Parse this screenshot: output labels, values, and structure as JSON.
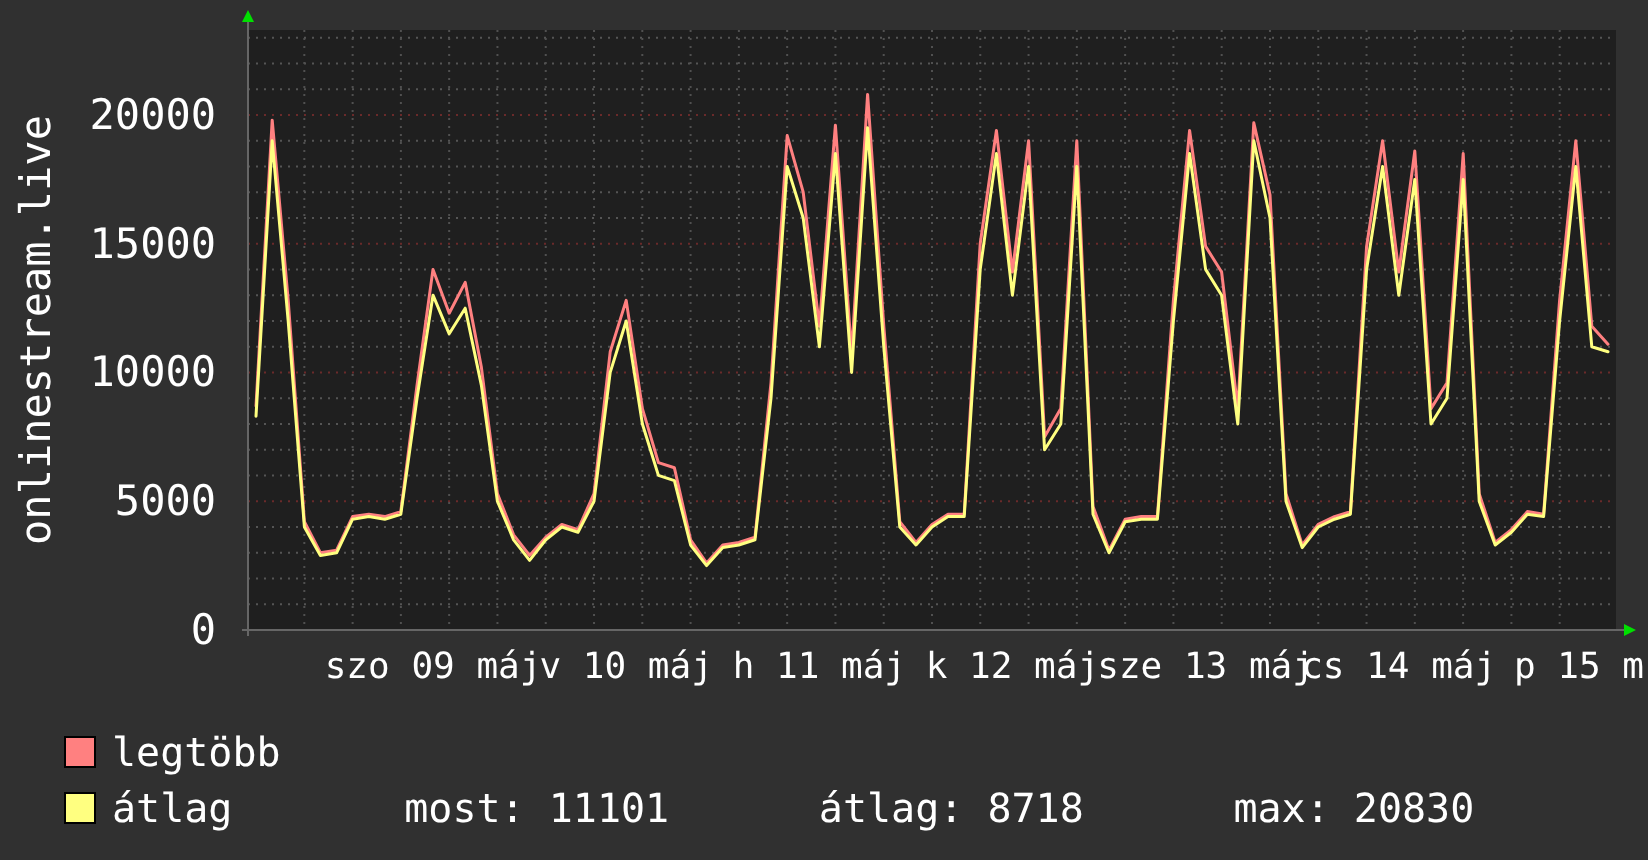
{
  "graph": {
    "chart_data": {
      "type": "line",
      "grid": true,
      "ylabel": "onlinestream.live",
      "ylim": [
        0,
        23300
      ],
      "yticks": [
        0,
        5000,
        10000,
        15000,
        20000
      ],
      "categories": [
        null,
        null,
        null,
        null,
        null,
        null,
        null,
        null,
        null,
        null,
        null,
        "szo 09 máj",
        null,
        null,
        null,
        null,
        null,
        null,
        null,
        null,
        null,
        null,
        null,
        "v 10 máj",
        null,
        null,
        null,
        null,
        null,
        null,
        null,
        null,
        null,
        null,
        null,
        "h 11 máj",
        null,
        null,
        null,
        null,
        null,
        null,
        null,
        null,
        null,
        null,
        null,
        "k 12 máj",
        null,
        null,
        null,
        null,
        null,
        null,
        null,
        null,
        null,
        null,
        null,
        "sze 13 máj",
        null,
        null,
        null,
        null,
        null,
        null,
        null,
        null,
        null,
        null,
        null,
        "cs 14 máj",
        null,
        null,
        null,
        null,
        null,
        null,
        null,
        null,
        null,
        null,
        null,
        "p 15 m",
        null
      ],
      "series": [
        {
          "name": "legtöbb",
          "color": "#ff8080",
          "values": [
            8700,
            19800,
            12800,
            4200,
            3000,
            3100,
            4400,
            4500,
            4400,
            4600,
            9500,
            14000,
            12300,
            13500,
            10200,
            5300,
            3700,
            2900,
            3600,
            4100,
            3900,
            5300,
            10800,
            12800,
            8600,
            6500,
            6300,
            3500,
            2600,
            3300,
            3400,
            3600,
            9600,
            19200,
            17000,
            11800,
            19600,
            10700,
            20800,
            11800,
            4200,
            3400,
            4100,
            4500,
            4500,
            15000,
            19400,
            13900,
            19000,
            7500,
            8600,
            19000,
            4800,
            3100,
            4300,
            4400,
            4400,
            12800,
            19400,
            14900,
            13900,
            8600,
            19700,
            16900,
            5300,
            3300,
            4100,
            4400,
            4600,
            14900,
            19000,
            13900,
            18600,
            8600,
            9600,
            18500,
            5300,
            3400,
            3900,
            4600,
            4500,
            12800,
            19000,
            11800,
            11100
          ]
        },
        {
          "name": "átlag",
          "color": "#ffff80",
          "values": [
            8300,
            19000,
            12000,
            4000,
            2900,
            3000,
            4300,
            4400,
            4300,
            4500,
            9000,
            13000,
            11500,
            12500,
            9500,
            5000,
            3500,
            2700,
            3500,
            4000,
            3800,
            5000,
            10000,
            12000,
            8000,
            6000,
            5800,
            3300,
            2500,
            3200,
            3300,
            3500,
            9000,
            18000,
            16000,
            11000,
            18500,
            10000,
            19500,
            11000,
            4000,
            3300,
            4000,
            4400,
            4400,
            14000,
            18500,
            13000,
            18000,
            7000,
            8000,
            18000,
            4500,
            3000,
            4200,
            4300,
            4300,
            12000,
            18500,
            14000,
            13000,
            8000,
            19000,
            16000,
            5000,
            3200,
            4000,
            4300,
            4500,
            14000,
            18000,
            13000,
            17500,
            8000,
            9000,
            17500,
            5000,
            3300,
            3800,
            4500,
            4400,
            12000,
            18000,
            11000,
            10800
          ]
        }
      ]
    }
  },
  "legend": {
    "stats": [
      "most: 11101",
      "átlag: 8718",
      "max: 20830"
    ]
  }
}
